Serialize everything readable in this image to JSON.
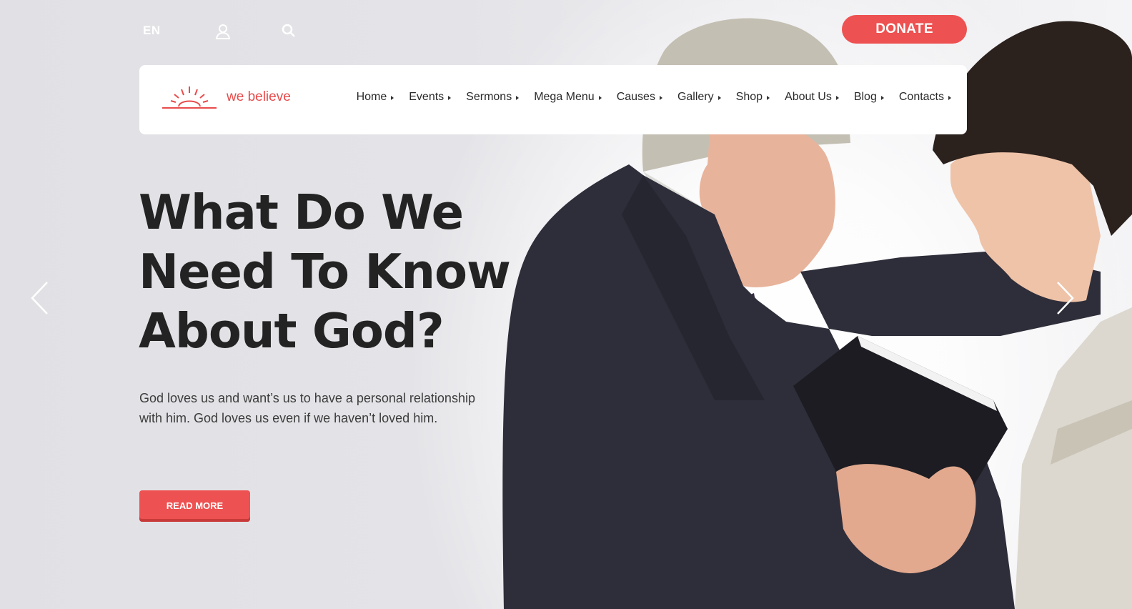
{
  "topbar": {
    "language": "EN",
    "icons": [
      "user-icon",
      "search-icon"
    ],
    "donate_label": "DONATE"
  },
  "header": {
    "logo_text": "we believe",
    "nav": [
      {
        "label": "Home"
      },
      {
        "label": "Events"
      },
      {
        "label": "Sermons"
      },
      {
        "label": "Mega Menu"
      },
      {
        "label": "Causes"
      },
      {
        "label": "Gallery"
      },
      {
        "label": "Shop"
      },
      {
        "label": "About Us"
      },
      {
        "label": "Blog"
      },
      {
        "label": "Contacts"
      }
    ]
  },
  "hero": {
    "title_line1": "What Do We",
    "title_line2": "Need To Know",
    "title_line3": "About God?",
    "body": "God loves us and want’s us to have a personal relationship with him. God loves us even if we haven’t loved him.",
    "button_label": "READ MORE",
    "image": "older-man-praying-with-young-man-photo"
  },
  "slider": {
    "prev_icon": "chevron-left-icon",
    "next_icon": "chevron-right-icon"
  },
  "colors": {
    "accent": "#ee5151",
    "heading": "#232323",
    "text": "#3c3c3c",
    "background": "#e2e2e6"
  }
}
